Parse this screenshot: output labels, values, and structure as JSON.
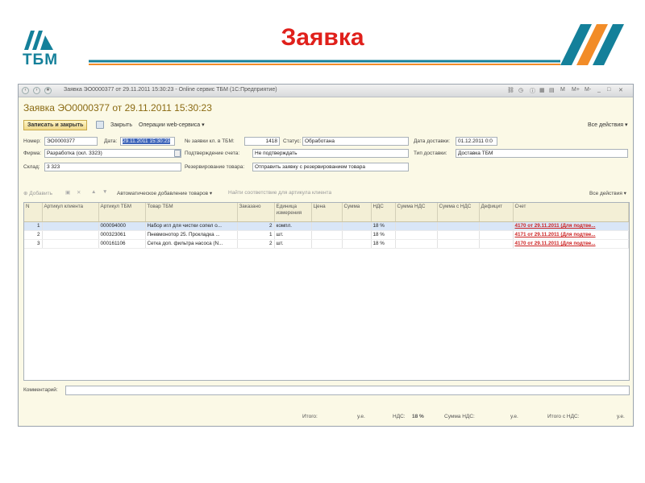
{
  "slide": {
    "logo_text": "ТБМ",
    "title": "Заявка",
    "colors": {
      "title": "#e0201b",
      "logo": "#14809a",
      "stripe_teal": "#14809a",
      "stripe_orange": "#f28c28"
    }
  },
  "window": {
    "title": "Заявка ЭО0000377 от 29.11.2011 15:30:23 - Online сервис ТБМ (1С:Предприятие)",
    "doc_title": "Заявка ЭО0000377 от 29.11.2011 15:30:23",
    "actions": {
      "save_close": "Записать и закрыть",
      "close": "Закрыть",
      "web_ops": "Операции web-сервиса ▾",
      "all_actions": "Все действия ▾"
    },
    "form": {
      "number_label": "Номер:",
      "number": "ЭО0000377",
      "date_label": "Дата:",
      "date": "29.11.2011 15:30:23",
      "tbm_order_label": "№ заявки кл. в ТБМ:",
      "tbm_order": "1418",
      "status_label": "Статус:",
      "status": "Обработана",
      "delivery_date_label": "Дата доставки:",
      "delivery_date": "01.12.2011 0:0",
      "firm_label": "Фирма:",
      "firm": "Разработка (скл. 3323)",
      "confirm_label": "Подтверждение счета:",
      "confirm": "Не подтверждать",
      "delivery_type_label": "Тип доставки:",
      "delivery_type": "Доставка ТБМ",
      "warehouse_label": "Склад:",
      "warehouse": "3 323",
      "reserve_label": "Резервирование товара:",
      "reserve": "Отправить заявку с резервированием товара"
    },
    "table_toolbar": {
      "add": "Добавить",
      "auto_add": "Автоматическое добавление товаров ▾",
      "find_match": "Найти соответствие для артикула клиента",
      "all_actions": "Все действия ▾"
    },
    "table": {
      "columns": [
        "N",
        "Артикул клиента",
        "Артикул ТБМ",
        "Товар ТБМ",
        "Заказано",
        "Единица измерения",
        "Цена",
        "Сумма",
        "НДС",
        "Сумма НДС",
        "Сумма с НДС",
        "Дефицит",
        "Счет"
      ],
      "rows": [
        {
          "n": "1",
          "client_art": "",
          "tbm_art": "000094000",
          "product": "Набор игл для чистки сопел о...",
          "ordered": "2",
          "unit": "компл.",
          "price": "",
          "sum": "",
          "vat": "18 %",
          "vat_sum": "",
          "sum_vat": "",
          "deficit": "",
          "invoice": "4170 от 29.11.2011 (Для подтве..."
        },
        {
          "n": "2",
          "client_art": "",
          "tbm_art": "000323061",
          "product": "Пневмонотор 25. Прокладка ...",
          "ordered": "1",
          "unit": "шт.",
          "price": "",
          "sum": "",
          "vat": "18 %",
          "vat_sum": "",
          "sum_vat": "",
          "deficit": "",
          "invoice": "4171 от 29.11.2011 (Для подтве..."
        },
        {
          "n": "3",
          "client_art": "",
          "tbm_art": "000161106",
          "product": "Сетка доп. фильтра насоса (N...",
          "ordered": "2",
          "unit": "шт.",
          "price": "",
          "sum": "",
          "vat": "18 %",
          "vat_sum": "",
          "sum_vat": "",
          "deficit": "",
          "invoice": "4170 от 29.11.2011 (Для подтве..."
        }
      ]
    },
    "comment_label": "Комментарий:",
    "footer": {
      "total_label": "Итого:",
      "total_unit": "у.е.",
      "vat_label": "НДС:",
      "vat_value": "18 %",
      "vat_sum_label": "Сумма НДС:",
      "vat_sum_unit": "у.е.",
      "total_vat_label": "Итого с НДС:",
      "total_vat_unit": "у.е."
    }
  }
}
